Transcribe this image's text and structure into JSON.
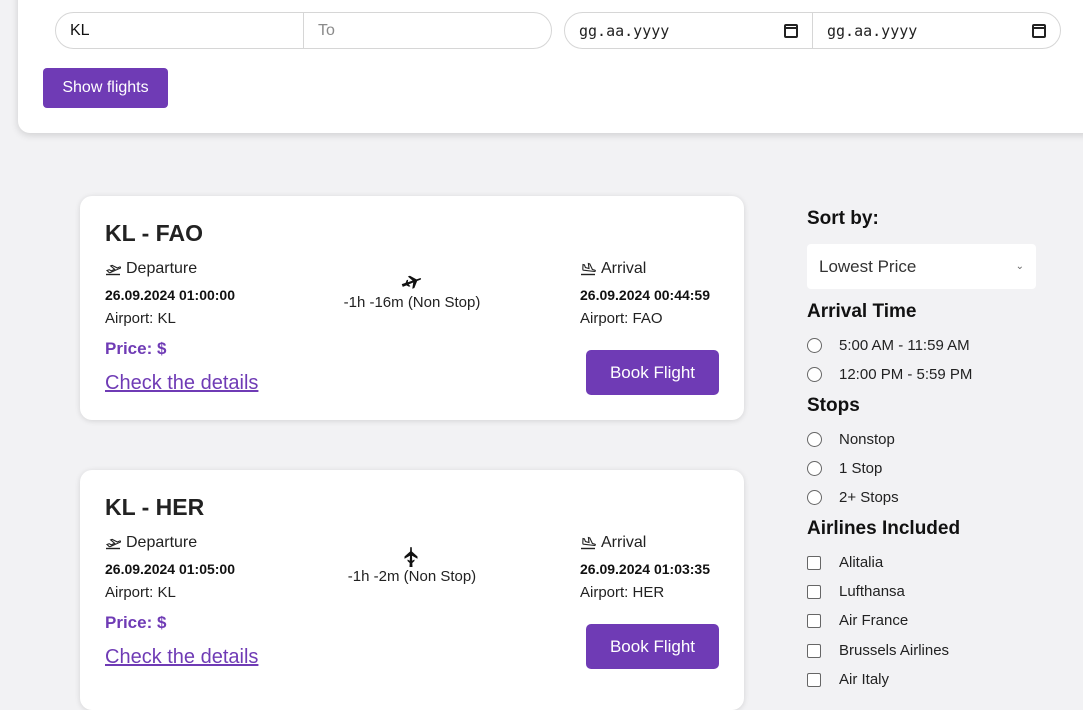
{
  "search": {
    "from_value": "KL",
    "to_placeholder": "To",
    "depart_date_placeholder": "gg.aa.yyyy",
    "return_date_placeholder": "gg.aa.yyyy",
    "show_button": "Show flights"
  },
  "flights": [
    {
      "route": "KL - FAO",
      "departure_label": "Departure",
      "departure_datetime": "26.09.2024 01:00:00",
      "departure_airport": "Airport: KL",
      "duration": "-1h -16m (Non Stop)",
      "arrival_label": "Arrival",
      "arrival_datetime": "26.09.2024 00:44:59",
      "arrival_airport": "Airport: FAO",
      "price": "Price: $",
      "details_link": "Check the details",
      "book_button": "Book Flight"
    },
    {
      "route": "KL - HER",
      "departure_label": "Departure",
      "departure_datetime": "26.09.2024 01:05:00",
      "departure_airport": "Airport: KL",
      "duration": "-1h -2m (Non Stop)",
      "arrival_label": "Arrival",
      "arrival_datetime": "26.09.2024 01:03:35",
      "arrival_airport": "Airport: HER",
      "price": "Price: $",
      "details_link": "Check the details",
      "book_button": "Book Flight"
    }
  ],
  "sidebar": {
    "sort_title": "Sort by:",
    "sort_selected": "Lowest Price",
    "arrival_time_title": "Arrival Time",
    "arrival_times": [
      "5:00 AM - 11:59 AM",
      "12:00 PM - 5:59 PM"
    ],
    "stops_title": "Stops",
    "stops": [
      "Nonstop",
      "1 Stop",
      "2+ Stops"
    ],
    "airlines_title": "Airlines Included",
    "airlines": [
      "Alitalia",
      "Lufthansa",
      "Air France",
      "Brussels Airlines",
      "Air Italy"
    ]
  },
  "colors": {
    "accent": "#6f3bb5",
    "background": "#f2f2f4",
    "card": "#ffffff"
  },
  "icons": {
    "departure": "plane-takeoff-icon",
    "arrival": "plane-landing-icon",
    "flight": "airplane-icon",
    "calendar": "calendar-icon",
    "dropdown": "chevron-down-icon"
  }
}
